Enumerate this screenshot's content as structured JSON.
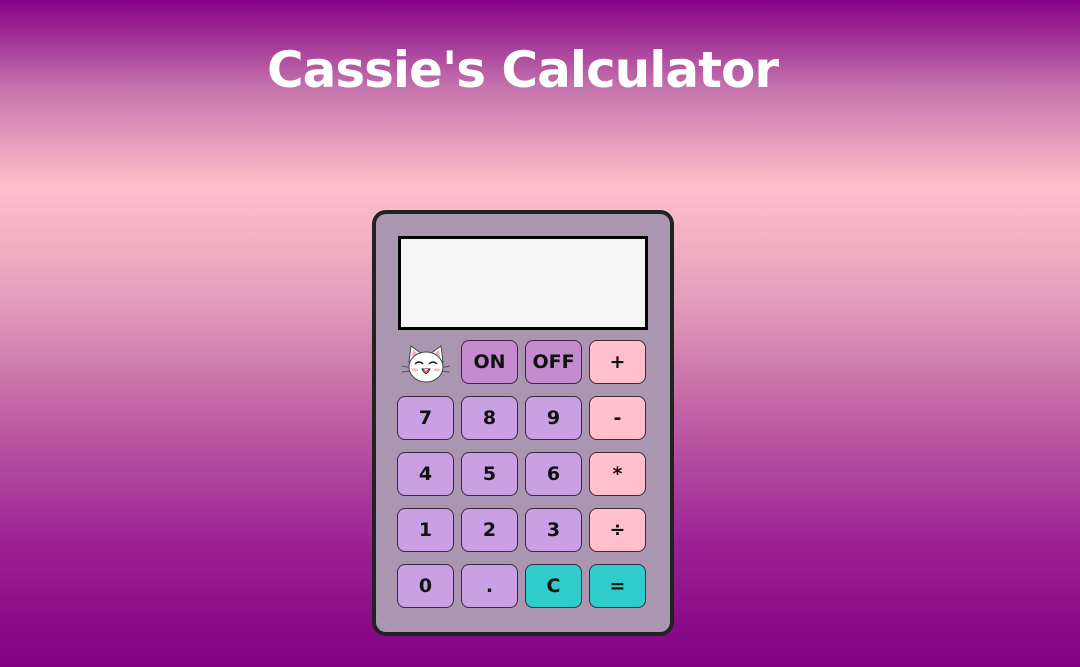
{
  "page": {
    "title": "Cassie's Calculator"
  },
  "display": {
    "value": ""
  },
  "mascot": {
    "icon": "cat-face-icon"
  },
  "keys": {
    "on": "ON",
    "off": "OFF",
    "plus": "+",
    "seven": "7",
    "eight": "8",
    "nine": "9",
    "minus": "-",
    "four": "4",
    "five": "5",
    "six": "6",
    "multiply": "*",
    "one": "1",
    "two": "2",
    "three": "3",
    "divide": "÷",
    "zero": "0",
    "decimal": ".",
    "clear": "C",
    "equals": "="
  },
  "colors": {
    "number_key": "#c9a0e4",
    "power_key": "#c48bcf",
    "operator_key": "#ffc0cb",
    "action_key": "#30cccc",
    "body": "#aa96b0"
  }
}
